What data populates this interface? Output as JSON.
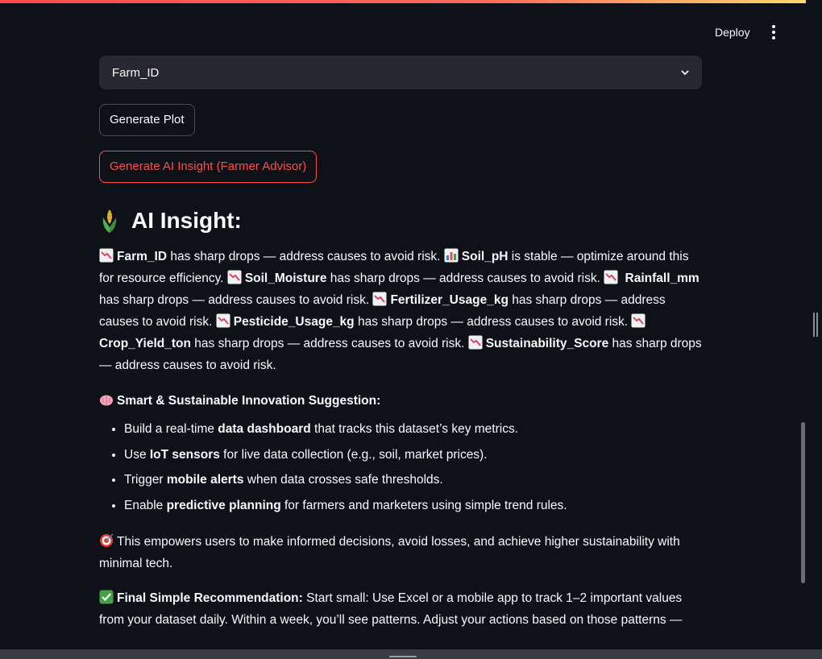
{
  "header": {
    "deploy_label": "Deploy"
  },
  "select": {
    "value": "Farm_ID"
  },
  "buttons": {
    "generate_plot": "Generate Plot",
    "generate_insight": "Generate AI Insight (Farmer Advisor)"
  },
  "insight": {
    "title": "AI Insight:",
    "parts": {
      "t_farm_id": "Farm_ID",
      "t_soil_ph": "Soil_pH",
      "t_soil_moisture": "Soil_Moisture",
      "t_rainfall": "Rainfall_mm",
      "t_fertilizer": "Fertilizer_Usage_kg",
      "t_pesticide": "Pesticide_Usage_kg",
      "t_crop_yield": "Crop_Yield_ton",
      "t_sustainability": "Sustainability_Score",
      "sharp_drops": " has sharp drops — address causes to avoid risk. ",
      "sharp_drops_end": " has sharp drops — address causes to avoid risk.",
      "stable": " is stable — optimize around this for resource efficiency. "
    }
  },
  "suggestion": {
    "heading": "Smart & Sustainable Innovation Suggestion:",
    "items": [
      {
        "pre": "Build a real-time ",
        "bold": "data dashboard",
        "post": " that tracks this dataset’s key metrics."
      },
      {
        "pre": "Use ",
        "bold": "IoT sensors",
        "post": " for live data collection (e.g., soil, market prices)."
      },
      {
        "pre": "Trigger ",
        "bold": "mobile alerts",
        "post": " when data crosses safe thresholds."
      },
      {
        "pre": "Enable ",
        "bold": "predictive planning",
        "post": " for farmers and marketers using simple trend rules."
      }
    ]
  },
  "empowers": "This empowers users to make informed decisions, avoid losses, and achieve higher sustainability with minimal tech.",
  "recommendation": {
    "label": "Final Simple Recommendation:",
    "text": " Start small: Use Excel or a mobile app to track 1–2 important values from your dataset daily. Within a week, you’ll see patterns. Adjust your actions based on those patterns —"
  },
  "icons": {
    "drop": "chart-decreasing-icon",
    "stable": "bar-chart-icon",
    "title": "corn-icon",
    "brain": "brain-icon",
    "target": "target-icon",
    "check": "check-mark-icon"
  }
}
